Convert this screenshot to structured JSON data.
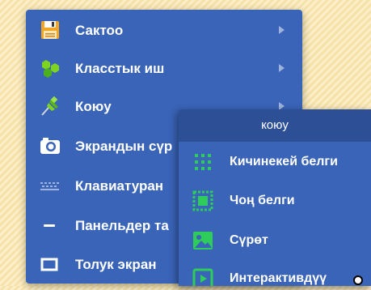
{
  "main_menu": {
    "items": [
      {
        "label": "Сактоо",
        "icon": "floppy-disk-icon",
        "has_submenu": true
      },
      {
        "label": "Класстык иш",
        "icon": "hexagons-icon",
        "has_submenu": true
      },
      {
        "label": "Коюу",
        "icon": "pushpin-icon",
        "has_submenu": true
      },
      {
        "label": "Экрандын сүр",
        "icon": "camera-icon",
        "has_submenu": false
      },
      {
        "label": "Клавиатуран",
        "icon": "keyboard-icon",
        "has_submenu": false
      },
      {
        "label": "Панельдер та",
        "icon": "minus-icon",
        "has_submenu": false
      },
      {
        "label": "Толук экран",
        "icon": "fullscreen-icon",
        "has_submenu": false
      }
    ]
  },
  "submenu": {
    "title": "коюу",
    "items": [
      {
        "label": "Кичинекей белги",
        "icon": "dots-grid-icon"
      },
      {
        "label": "Чоң белги",
        "icon": "stamp-icon"
      },
      {
        "label": "Сүрөт",
        "icon": "image-icon"
      },
      {
        "label": "Интерактивдүү",
        "icon": "play-icon"
      }
    ]
  },
  "colors": {
    "menu_bg": "#3a64b8",
    "submenu_header_bg": "#2c4f95",
    "icon_green": "#2ecc5a",
    "background": "#fbeec8"
  }
}
